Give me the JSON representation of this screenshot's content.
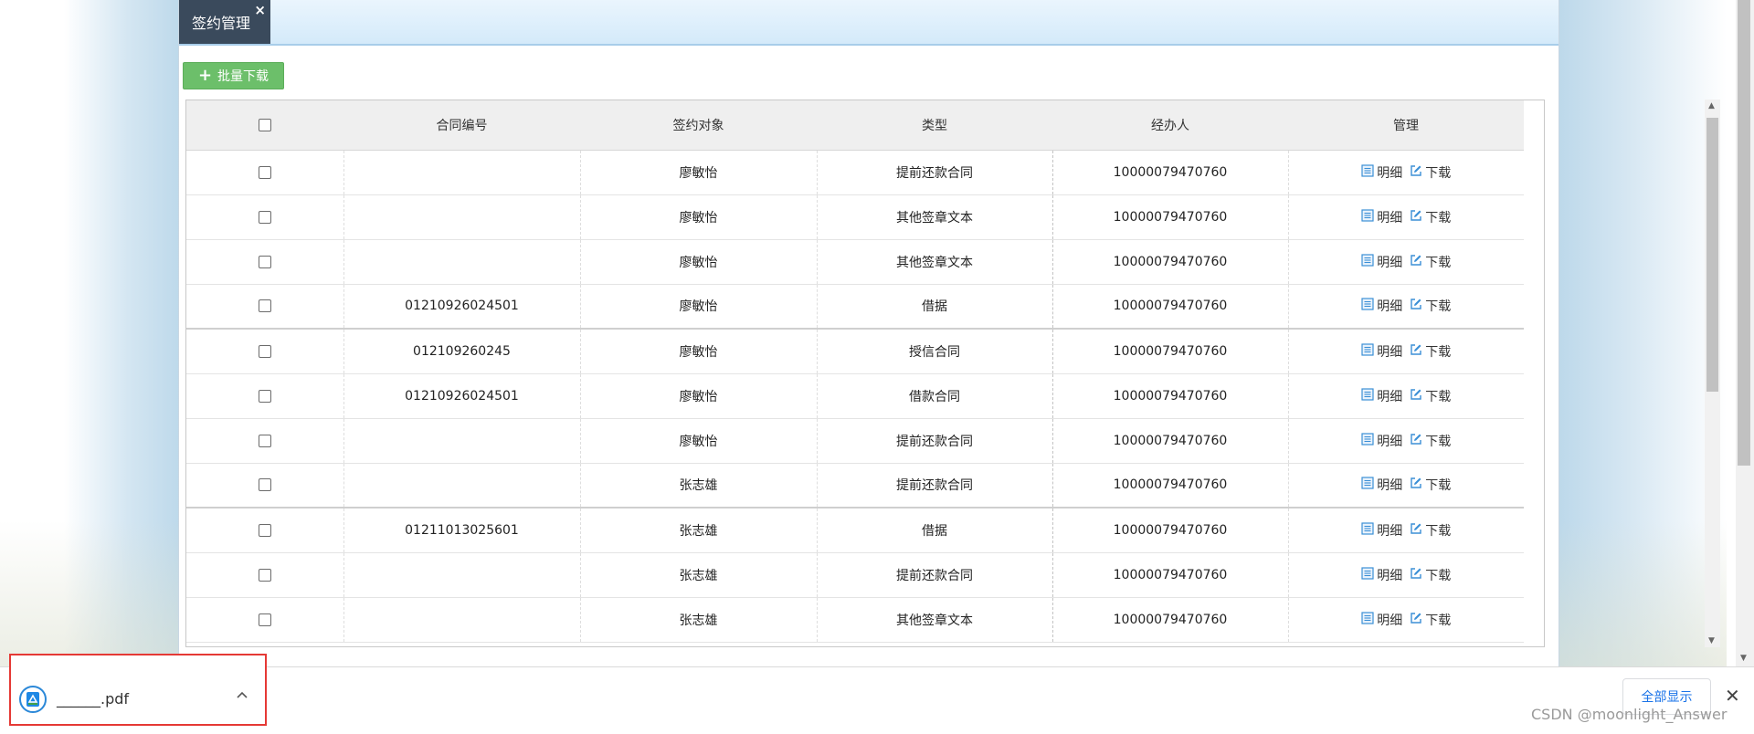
{
  "tab": {
    "title": "签约管理",
    "close": "×"
  },
  "toolbar": {
    "batch_download_label": "批量下载"
  },
  "table": {
    "headers": [
      "合同编号",
      "签约对象",
      "类型",
      "经办人",
      "管理"
    ],
    "rows": [
      {
        "contract_no": "",
        "party": "廖敏怡",
        "type": "提前还款合同",
        "agent": "10000079470760"
      },
      {
        "contract_no": "",
        "party": "廖敏怡",
        "type": "其他签章文本",
        "agent": "10000079470760"
      },
      {
        "contract_no": "",
        "party": "廖敏怡",
        "type": "其他签章文本",
        "agent": "10000079470760"
      },
      {
        "contract_no": "01210926024501",
        "party": "廖敏怡",
        "type": "借据",
        "agent": "10000079470760"
      },
      {
        "contract_no": "012109260245",
        "party": "廖敏怡",
        "type": "授信合同",
        "agent": "10000079470760"
      },
      {
        "contract_no": "01210926024501",
        "party": "廖敏怡",
        "type": "借款合同",
        "agent": "10000079470760"
      },
      {
        "contract_no": "",
        "party": "廖敏怡",
        "type": "提前还款合同",
        "agent": "10000079470760"
      },
      {
        "contract_no": "",
        "party": "张志雄",
        "type": "提前还款合同",
        "agent": "10000079470760"
      },
      {
        "contract_no": "01211013025601",
        "party": "张志雄",
        "type": "借据",
        "agent": "10000079470760"
      },
      {
        "contract_no": "",
        "party": "张志雄",
        "type": "提前还款合同",
        "agent": "10000079470760"
      },
      {
        "contract_no": "",
        "party": "张志雄",
        "type": "其他签章文本",
        "agent": "10000079470760"
      }
    ],
    "actions": {
      "detail": "明细",
      "download": "下载"
    }
  },
  "download_bar": {
    "file_name": "______.pdf",
    "show_all_label": "全部显示",
    "close": "✕"
  },
  "watermark": "CSDN @moonlight_Answer",
  "icons": {
    "tab_close": "close-icon",
    "batch": "plus-icon",
    "detail": "document-icon",
    "download": "edit-icon",
    "file": "pdf-icon",
    "chevron": "chevron-up-icon"
  },
  "colors": {
    "tab_bg": "#3a4a5c",
    "batch_button": "#6cbf6a",
    "action_icon": "#3b8fd6",
    "highlight_border": "#e53935",
    "link_blue": "#1a73e8"
  }
}
